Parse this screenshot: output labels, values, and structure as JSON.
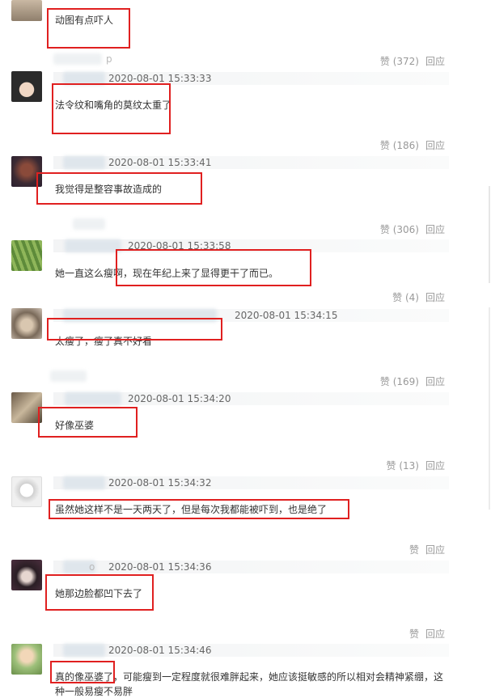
{
  "time_prefix": "2020-08-01",
  "comments": [
    {
      "time": "",
      "content": "动图有点吓人",
      "likes": "赞 (372)",
      "reply": "回应"
    },
    {
      "time": "2020-08-01 15:33:33",
      "content": "法令纹和嘴角的莫纹太重了",
      "likes": "赞 (186)",
      "reply": "回应"
    },
    {
      "time": "2020-08-01 15:33:41",
      "content": "我觉得是整容事故造成的",
      "likes": "赞 (306)",
      "reply": "回应"
    },
    {
      "time": "2020-08-01 15:33:58",
      "content": "她一直这么瘦啊，现在年纪上来了显得更干了而已。",
      "likes": "赞 (4)",
      "reply": "回应"
    },
    {
      "time": "2020-08-01 15:34:15",
      "content": "太瘦了，瘦了真不好看",
      "likes": "赞 (169)",
      "reply": "回应"
    },
    {
      "time": "2020-08-01 15:34:20",
      "content": "好像巫婆",
      "likes": "赞 (13)",
      "reply": "回应"
    },
    {
      "time": "2020-08-01 15:34:32",
      "content": "虽然她这样不是一天两天了，但是每次我都能被吓到，也是绝了",
      "likes": "赞",
      "reply": "回应"
    },
    {
      "time": "2020-08-01 15:34:36",
      "content": "她那边脸都凹下去了",
      "likes": "赞",
      "reply": "回应"
    },
    {
      "time": "2020-08-01 15:34:46",
      "content": "真的像巫婆了，可能瘦到一定程度就很难胖起来，她应该挺敏感的所以相对会精神紧绷，这",
      "content2": "种一般易瘦不易胖",
      "likes": "",
      "reply": ""
    }
  ],
  "name_fragments": {
    "c0": "p",
    "c1": "宪",
    "c8": "o"
  },
  "colors": {
    "highlight": "#e02020",
    "meta_bg": "#f3f4f5",
    "muted": "#999999"
  }
}
